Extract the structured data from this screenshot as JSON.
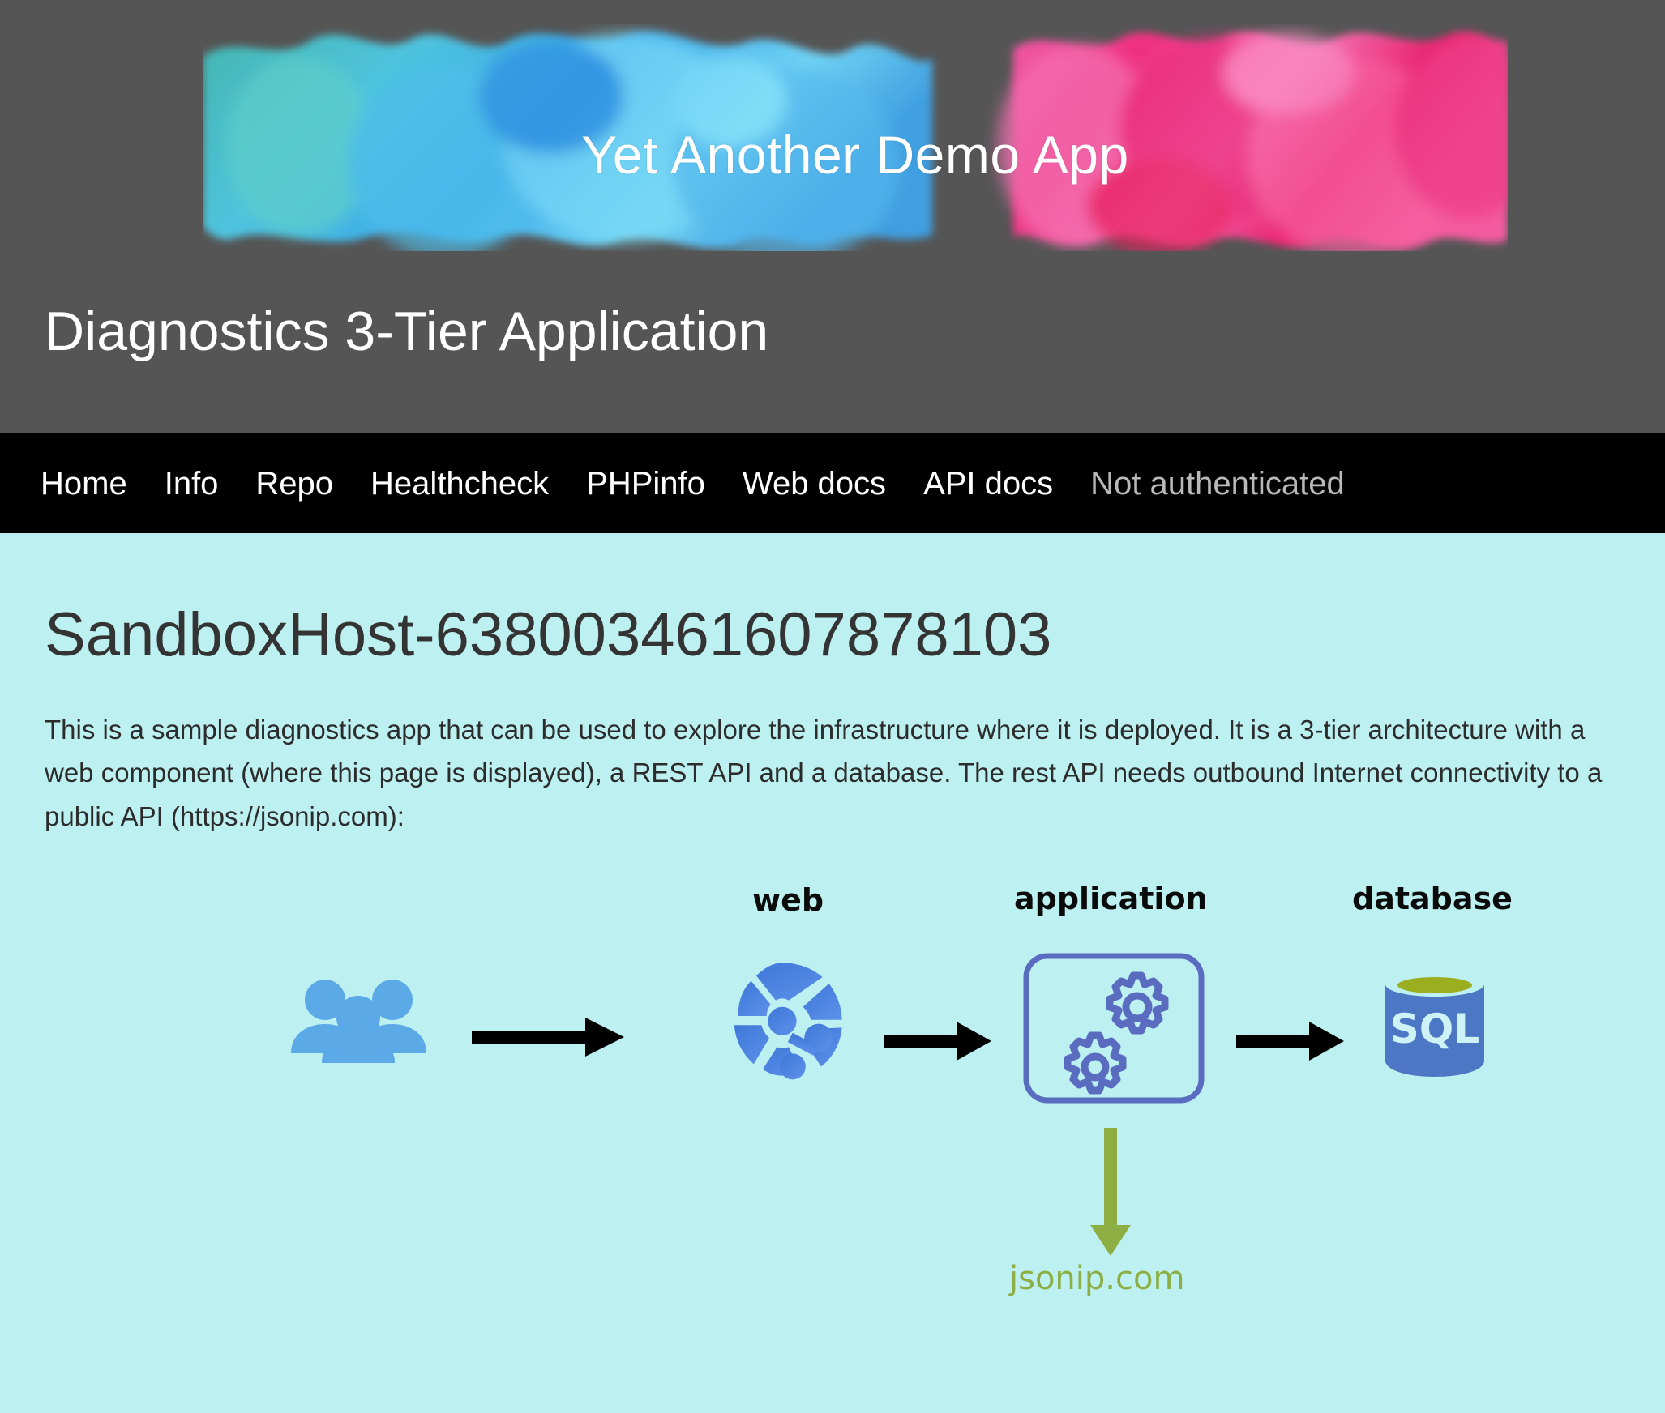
{
  "header": {
    "banner_title": "Yet Another Demo App",
    "site_title": "Diagnostics 3-Tier Application",
    "banner_icon": "ink-splash-banner-image",
    "colors": {
      "header_bg": "#555555",
      "navbar_bg": "#000000",
      "content_bg": "#bdf0f1",
      "banner_left": "#49c6e6",
      "banner_right": "#ef3f8f"
    }
  },
  "nav": {
    "items": [
      {
        "label": "Home",
        "state": "link"
      },
      {
        "label": "Info",
        "state": "link"
      },
      {
        "label": "Repo",
        "state": "link"
      },
      {
        "label": "Healthcheck",
        "state": "link"
      },
      {
        "label": "PHPinfo",
        "state": "link"
      },
      {
        "label": "Web docs",
        "state": "link"
      },
      {
        "label": "API docs",
        "state": "link"
      },
      {
        "label": "Not authenticated",
        "state": "muted"
      }
    ]
  },
  "main": {
    "hostname": "SandboxHost-638003461607878103",
    "intro": "This is a sample diagnostics app that can be used to explore the infrastructure where it is deployed. It is a 3-tier architecture with a web component (where this page is displayed), a REST API and a database. The rest API needs outbound Internet connectivity to a public API (https://jsonip.com):"
  },
  "diagram": {
    "nodes": [
      {
        "key": "users",
        "label": "",
        "icon": "users-group-icon",
        "color": "#5ca9e8"
      },
      {
        "key": "web",
        "label": "web",
        "icon": "web-globe-icon",
        "color": "#4a77d4"
      },
      {
        "key": "application",
        "label": "application",
        "icon": "gears-icon",
        "color": "#5a6cc0"
      },
      {
        "key": "database",
        "label": "database",
        "icon": "sql-database-icon",
        "color": "#4b77c4"
      }
    ],
    "arrows": [
      {
        "key": "users-to-web",
        "icon": "arrow-right-icon",
        "color": "#000000"
      },
      {
        "key": "web-to-application",
        "icon": "arrow-right-icon",
        "color": "#000000"
      },
      {
        "key": "application-to-database",
        "icon": "arrow-right-icon",
        "color": "#000000"
      },
      {
        "key": "application-to-jsonip",
        "icon": "arrow-down-icon",
        "color": "#8cae43"
      }
    ],
    "external_label": "jsonip.com",
    "db_text": "SQL"
  }
}
